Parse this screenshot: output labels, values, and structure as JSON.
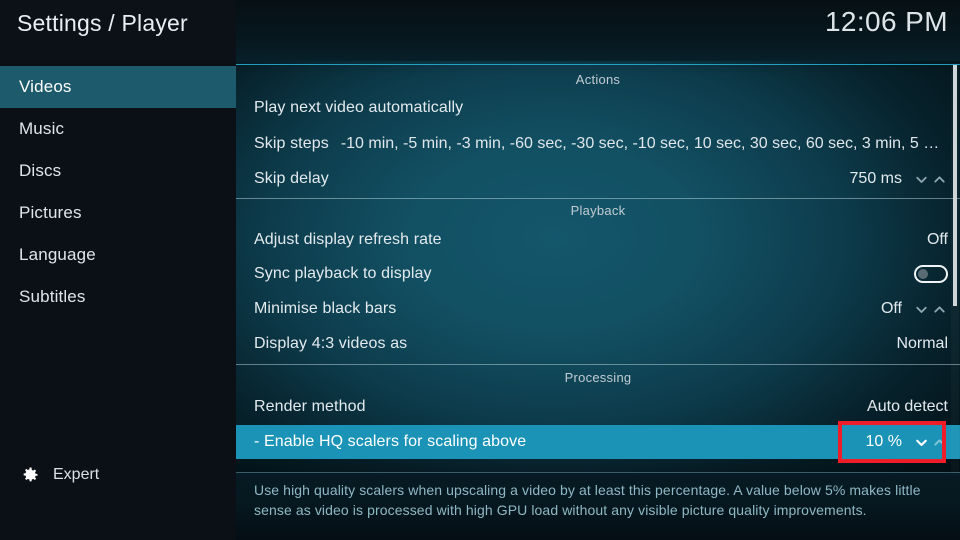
{
  "header": {
    "title": "Settings / Player",
    "clock": "12:06 PM"
  },
  "sidebar": {
    "items": [
      {
        "label": "Videos",
        "selected": true
      },
      {
        "label": "Music",
        "selected": false
      },
      {
        "label": "Discs",
        "selected": false
      },
      {
        "label": "Pictures",
        "selected": false
      },
      {
        "label": "Language",
        "selected": false
      },
      {
        "label": "Subtitles",
        "selected": false
      }
    ],
    "level_button": {
      "label": "Expert",
      "icon": "gear-icon"
    }
  },
  "content": {
    "sections": [
      {
        "header": "Actions",
        "rows": [
          {
            "label": "Play next video automatically",
            "value": "",
            "control": "none"
          },
          {
            "label": "Skip steps",
            "inline_value": "-10 min, -5 min, -3 min, -60 sec, -30 sec, -10 sec, 10 sec, 30 sec, 60 sec, 3 min, 5 min,...",
            "control": "none"
          },
          {
            "label": "Skip delay",
            "value": "750 ms",
            "control": "spinner"
          }
        ]
      },
      {
        "header": "Playback",
        "rows": [
          {
            "label": "Adjust display refresh rate",
            "value": "Off",
            "control": "none"
          },
          {
            "label": "Sync playback to display",
            "value": "",
            "control": "toggle",
            "toggle_state": "off"
          },
          {
            "label": "Minimise black bars",
            "value": "Off",
            "control": "spinner"
          },
          {
            "label": "Display 4:3 videos as",
            "value": "Normal",
            "control": "none"
          }
        ]
      },
      {
        "header": "Processing",
        "rows": [
          {
            "label": "Render method",
            "value": "Auto detect",
            "control": "none"
          },
          {
            "label": "- Enable HQ scalers for scaling above",
            "value": "10 %",
            "control": "spinner",
            "selected": true
          }
        ]
      }
    ]
  },
  "description": {
    "text": "Use high quality scalers when upscaling a video by at least this percentage. A value below 5% makes little sense as video is processed with high GPU load without any visible picture quality improvements."
  },
  "colors": {
    "selected_row": "#1b93b6",
    "sidebar_selected": "#1d5a6c",
    "focus_outline": "#ef1d28",
    "accent_rule": "#2ab4d8",
    "description_text": "#8fb8c4"
  }
}
